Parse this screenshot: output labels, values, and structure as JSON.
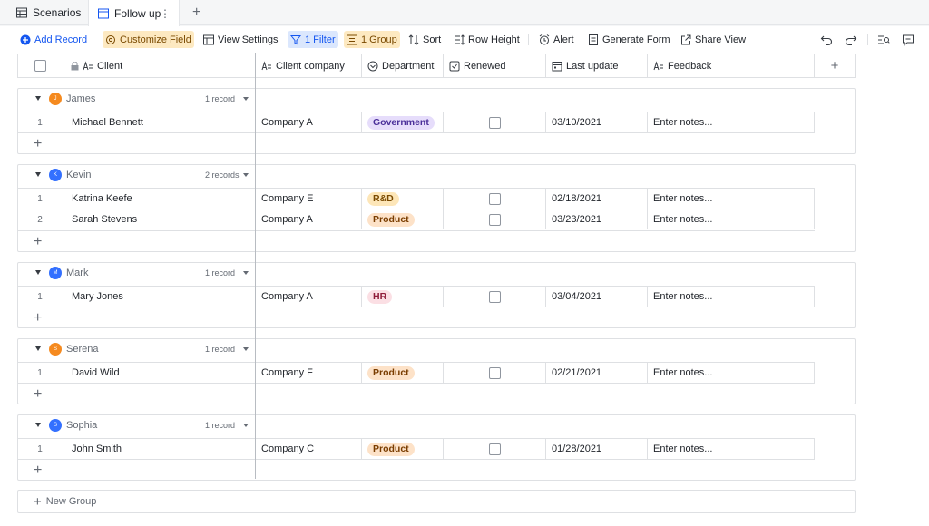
{
  "tabs": [
    {
      "label": "Scenarios",
      "icon": "table-icon"
    },
    {
      "label": "Follow up",
      "icon": "grid-view-icon",
      "active": true
    }
  ],
  "toolbar": {
    "add_record": "Add Record",
    "customize_field": "Customize Field",
    "view_settings": "View Settings",
    "filter": "1 Filter",
    "group": "1 Group",
    "sort": "Sort",
    "row_height": "Row Height",
    "alert": "Alert",
    "generate_form": "Generate Form",
    "share_view": "Share View"
  },
  "columns": {
    "client": "Client",
    "company": "Client company",
    "department": "Department",
    "renewed": "Renewed",
    "last_update": "Last update",
    "feedback": "Feedback"
  },
  "groups": [
    {
      "name": "James",
      "initial": "J",
      "color": "#f58a1f",
      "count": "1 record",
      "rows": [
        {
          "num": "1",
          "client": "Michael Bennett",
          "company": "Company A",
          "dept": "Government",
          "renewed": false,
          "date": "03/10/2021",
          "feedback": "Enter notes..."
        }
      ]
    },
    {
      "name": "Kevin",
      "initial": "K",
      "color": "#3370ff",
      "count": "2 records",
      "rows": [
        {
          "num": "1",
          "client": "Katrina Keefe",
          "company": "Company E",
          "dept": "R&D",
          "renewed": false,
          "date": "02/18/2021",
          "feedback": "Enter notes..."
        },
        {
          "num": "2",
          "client": "Sarah Stevens",
          "company": "Company A",
          "dept": "Product",
          "renewed": false,
          "date": "03/23/2021",
          "feedback": "Enter notes..."
        }
      ]
    },
    {
      "name": "Mark",
      "initial": "M",
      "color": "#3370ff",
      "count": "1 record",
      "rows": [
        {
          "num": "1",
          "client": "Mary Jones",
          "company": "Company A",
          "dept": "HR",
          "renewed": false,
          "date": "03/04/2021",
          "feedback": "Enter notes..."
        }
      ]
    },
    {
      "name": "Serena",
      "initial": "S",
      "color": "#f58a1f",
      "count": "1 record",
      "rows": [
        {
          "num": "1",
          "client": "David Wild",
          "company": "Company F",
          "dept": "Product",
          "renewed": false,
          "date": "02/21/2021",
          "feedback": "Enter notes..."
        }
      ]
    },
    {
      "name": "Sophia",
      "initial": "S",
      "color": "#3370ff",
      "count": "1 record",
      "rows": [
        {
          "num": "1",
          "client": "John Smith",
          "company": "Company C",
          "dept": "Product",
          "renewed": false,
          "date": "01/28/2021",
          "feedback": "Enter notes..."
        }
      ]
    }
  ],
  "dept_colors": {
    "Government": {
      "bg": "#e6ddfb",
      "fg": "#4a2f99"
    },
    "R&D": {
      "bg": "#fde6b8",
      "fg": "#7a4a00"
    },
    "Product": {
      "bg": "#fde2c8",
      "fg": "#7a3d00"
    },
    "HR": {
      "bg": "#fbdfe4",
      "fg": "#8f1d3a"
    }
  },
  "new_group": "New Group"
}
